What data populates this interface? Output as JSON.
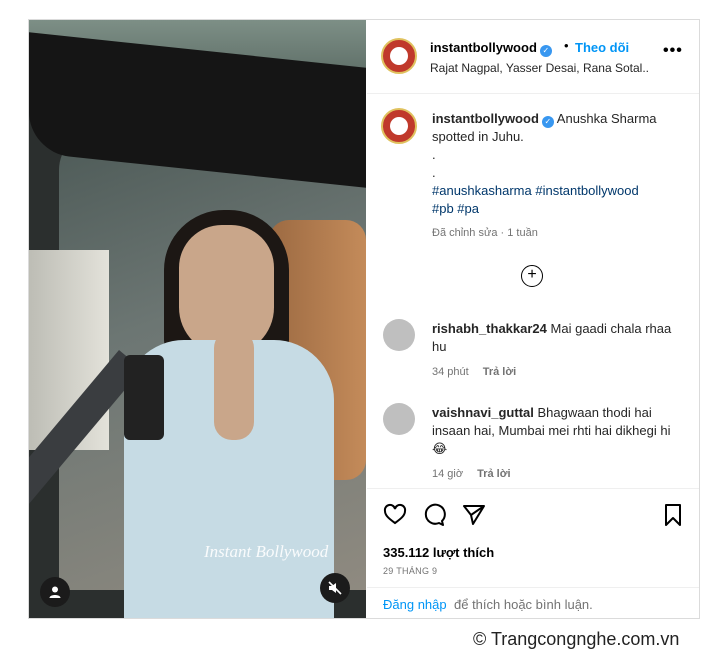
{
  "header": {
    "username": "instantbollywood",
    "follow_label": "Theo dõi",
    "dot": "•",
    "more": "•••",
    "subtitle": "Rajat Nagpal, Yasser Desai, Rana Sotal..."
  },
  "caption": {
    "username": "instantbollywood",
    "text": "Anushka Sharma spotted in Juhu.",
    "line1": ".",
    "line2": ".",
    "hashtags_line1": "#anushkasharma #instantbollywood",
    "hashtags_line2": "#pb #pa",
    "meta": "Đã chỉnh sửa · 1 tuần"
  },
  "comments": [
    {
      "username": "rishabh_thakkar24",
      "text": "Mai gaadi chala rhaa hu",
      "time": "34 phút",
      "reply": "Trả lời"
    },
    {
      "username": "vaishnavi_guttal",
      "text": "Bhagwaan thodi hai insaan hai, Mumbai mei rhti hai dikhegi hi😂",
      "time": "14 giờ",
      "reply": "Trả lời"
    }
  ],
  "media": {
    "watermark": "Instant Bollywood"
  },
  "actions": {
    "likes": "335.112 lượt thích",
    "date": "29 THÁNG 9"
  },
  "login": {
    "link": "Đăng nhập",
    "rest": "để thích hoặc bình luận."
  },
  "credit": "© Trangcongnghe.com.vn",
  "colors": {
    "accent": "#0095f6",
    "hashtag": "#00376b",
    "muted": "#737373"
  }
}
